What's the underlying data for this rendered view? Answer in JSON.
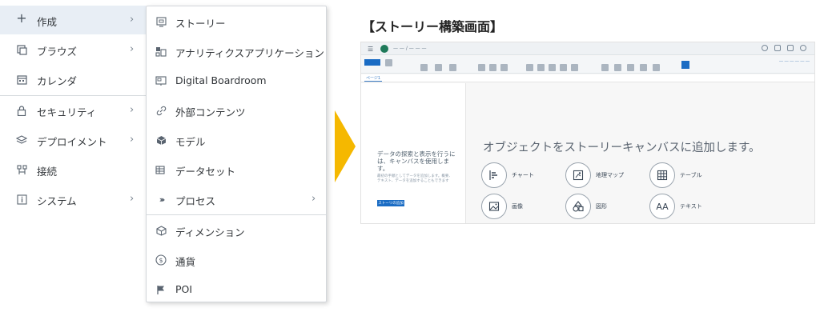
{
  "nav": {
    "items": [
      {
        "label": "作成",
        "icon": "plus-icon",
        "chevron": true,
        "active": true
      },
      {
        "label": "ブラウズ",
        "icon": "browse-icon",
        "chevron": true,
        "active": false
      },
      {
        "label": "カレンダ",
        "icon": "calendar-icon",
        "chevron": false,
        "active": false
      },
      {
        "label": "セキュリティ",
        "icon": "lock-icon",
        "chevron": true,
        "active": false
      },
      {
        "label": "デプロイメント",
        "icon": "deploy-icon",
        "chevron": true,
        "active": false
      },
      {
        "label": "接続",
        "icon": "connection-icon",
        "chevron": false,
        "active": false
      },
      {
        "label": "システム",
        "icon": "info-icon",
        "chevron": true,
        "active": false
      }
    ]
  },
  "flyout": {
    "items": [
      {
        "label": "ストーリー",
        "icon": "story-icon",
        "chevron": false
      },
      {
        "label": "アナリティクスアプリケーション",
        "icon": "analytics-application-icon",
        "chevron": false
      },
      {
        "label": "Digital Boardroom",
        "icon": "boardroom-icon",
        "chevron": false
      },
      {
        "label": "外部コンテンツ",
        "icon": "link-icon",
        "chevron": false
      },
      {
        "label": "モデル",
        "icon": "model-icon",
        "chevron": false
      },
      {
        "label": "データセット",
        "icon": "dataset-icon",
        "chevron": false
      },
      {
        "label": "プロセス",
        "icon": "process-icon",
        "chevron": true
      },
      {
        "label": "ディメンション",
        "icon": "dimension-icon",
        "chevron": false
      },
      {
        "label": "通貨",
        "icon": "currency-icon",
        "chevron": false
      },
      {
        "label": "POI",
        "icon": "flag-icon",
        "chevron": false
      }
    ]
  },
  "heading": "【ストーリー構築画面】",
  "app": {
    "tab_label": "ページ1",
    "left_title": "データの探索と表示を行うには、キャンバスを使用します。",
    "left_desc": "最初の手順としてデータを追加します。概要、テキスト、データを追加することもできます",
    "left_button": "ストーリの追加",
    "canvas_title": "オブジェクトをストーリーキャンバスに追加します。",
    "objects": [
      {
        "label": "チャート",
        "icon": "chart-icon"
      },
      {
        "label": "地理マップ",
        "icon": "geo-map-icon"
      },
      {
        "label": "テーブル",
        "icon": "table-icon"
      },
      {
        "label": "画像",
        "icon": "image-icon"
      },
      {
        "label": "図形",
        "icon": "shape-icon"
      },
      {
        "label": "テキスト",
        "icon": "text-icon"
      }
    ]
  },
  "colors": {
    "accent": "#1a6cc4",
    "arrow": "#f5b800",
    "active_nav": "#e8eef5"
  }
}
